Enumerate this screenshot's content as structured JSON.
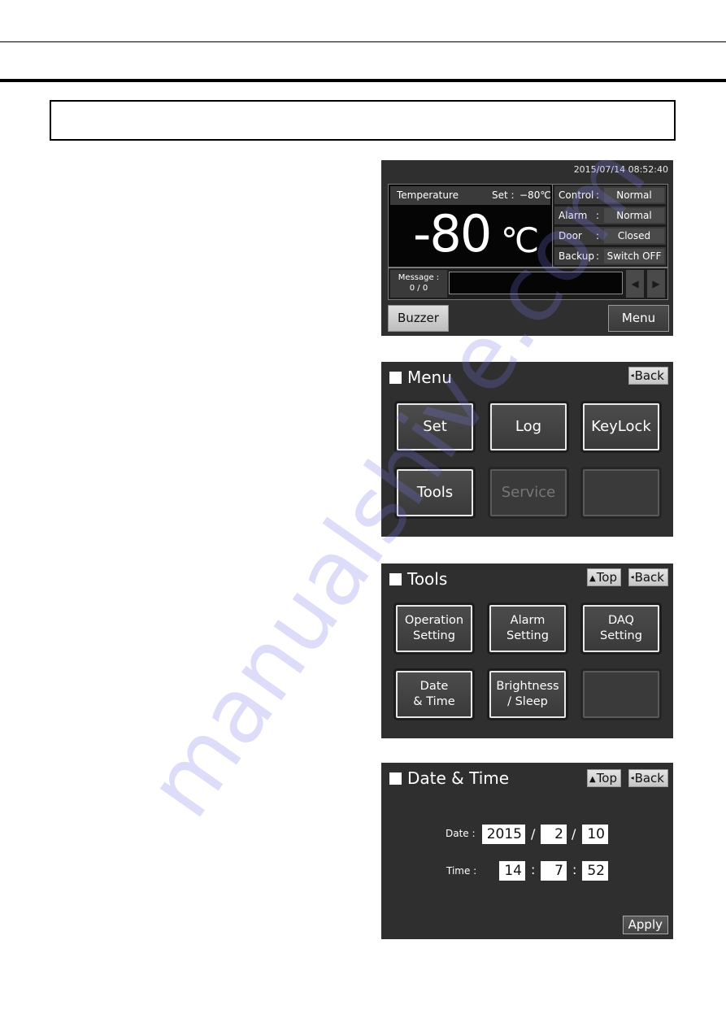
{
  "page": {
    "heading_box_text": "",
    "watermark": "manualshive.com"
  },
  "screen_main": {
    "timestamp": "2015/07/14  08:52:40",
    "temperature_label": "Temperature",
    "set_label": "Set :",
    "set_value": "−80℃",
    "current_temp": "-80",
    "temp_unit": "℃",
    "status": [
      {
        "key": "Control",
        "colon": ":",
        "value": "Normal"
      },
      {
        "key": "Alarm",
        "colon": ":",
        "value": "Normal"
      },
      {
        "key": "Door",
        "colon": ":",
        "value": "Closed"
      },
      {
        "key": "Backup",
        "colon": ":",
        "value": "Switch OFF"
      }
    ],
    "message_label": "Message :",
    "message_count": "0 / 0",
    "message_text": "",
    "prev_glyph": "◀",
    "next_glyph": "▶",
    "buzzer_label": "Buzzer",
    "menu_label": "Menu"
  },
  "screen_menu": {
    "title": "Menu",
    "back_glyph": "◂",
    "back_label": "Back",
    "tiles": [
      "Set",
      "Log",
      "KeyLock",
      "Tools",
      "Service",
      ""
    ]
  },
  "screen_tools": {
    "title": "Tools",
    "top_glyph": "🡅",
    "top_label": "Top",
    "back_glyph": "◂",
    "back_label": "Back",
    "tiles": [
      {
        "line1": "Operation",
        "line2": "Setting"
      },
      {
        "line1": "Alarm",
        "line2": "Setting"
      },
      {
        "line1": "DAQ",
        "line2": "Setting"
      },
      {
        "line1": "Date",
        "line2": "& Time"
      },
      {
        "line1": "Brightness",
        "line2": "/ Sleep"
      },
      {
        "line1": "",
        "line2": ""
      }
    ]
  },
  "screen_datetime": {
    "title": "Date & Time",
    "top_glyph": "🡅",
    "top_label": "Top",
    "back_glyph": "◂",
    "back_label": "Back",
    "date_label": "Date :",
    "year": "2015",
    "month": "2",
    "day": "10",
    "date_sep": "/",
    "time_label": "Time :",
    "hour": "14",
    "minute": "7",
    "second": "52",
    "time_sep": ":",
    "apply_label": "Apply"
  }
}
